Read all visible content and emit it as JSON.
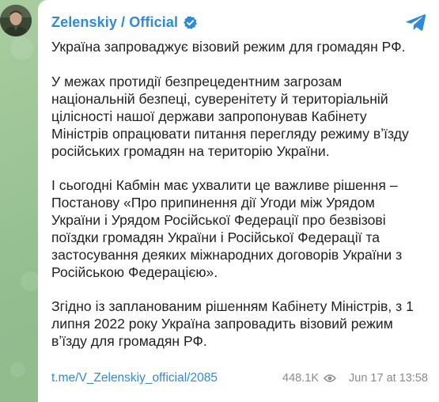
{
  "channel": {
    "name": "Zelenskiy / Official",
    "verified_icon": "verified-badge-icon",
    "avatar": "channel-avatar",
    "app_icon": "telegram-icon",
    "accent_color": "#2f8ad8"
  },
  "post": {
    "paragraphs": [
      "Україна запроваджує візовий режим для громадян РФ.",
      "У межах протидії безпрецедентним загрозам національній безпеці, суверенітету й територіальній цілісності нашої держави запропонував Кабінету Міністрів опрацювати питання перегляду режиму вʼїзду російських громадян на територію України.",
      "І сьогодні Кабмін має ухвалити це важливе рішення – Постанову «Про припинення дії Угоди між Урядом України і Урядом Російської Федерації про безвізові поїздки громадян України і Російської Федерації та застосування деяких міжнародних договорів України з Російською Федерацією».",
      "Згідно із запланованим рішенням Кабінету Міністрів, з 1 липня 2022 року Україна запровадить візовий режим вʼїзду для громадян РФ."
    ]
  },
  "footer": {
    "link": "t.me/V_Zelenskiy_official/2085",
    "views": "448.1K",
    "views_icon": "eye-icon",
    "timestamp": "Jun 17 at 13:58"
  },
  "colors": {
    "background": "#9fc49a",
    "text": "#222222",
    "meta": "#8c8c8c"
  }
}
